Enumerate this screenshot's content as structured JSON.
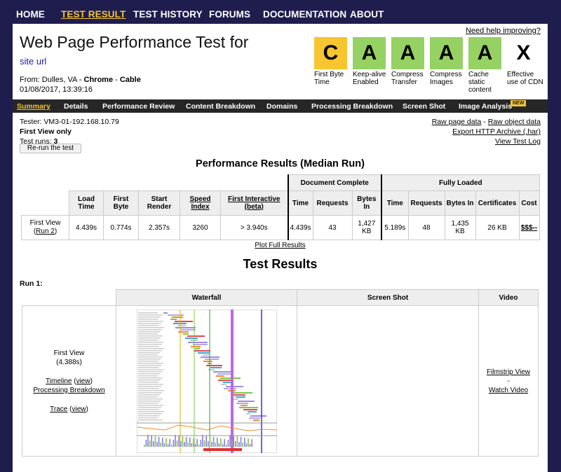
{
  "nav": {
    "items": [
      "HOME",
      "TEST RESULT",
      "TEST HISTORY",
      "FORUMS",
      "DOCUMENTATION",
      "ABOUT"
    ]
  },
  "header": {
    "title": "Web Page Performance Test for",
    "site": "site url",
    "from_label": "From:",
    "from_location": "Dulles, VA",
    "browser": "Chrome",
    "connection": "Cable",
    "timestamp": "01/08/2017, 13:39:16",
    "help_link": "Need help improving?"
  },
  "grades": [
    {
      "letter": "C",
      "label": "First Byte Time",
      "color": "#f7c52f"
    },
    {
      "letter": "A",
      "label": "Keep-alive Enabled",
      "color": "#96d163"
    },
    {
      "letter": "A",
      "label": "Compress Transfer",
      "color": "#96d163"
    },
    {
      "letter": "A",
      "label": "Compress Images",
      "color": "#96d163"
    },
    {
      "letter": "A",
      "label": "Cache static content",
      "color": "#96d163"
    },
    {
      "letter": "X",
      "label": "Effective use of CDN",
      "color": "#ffffff"
    }
  ],
  "subnav": {
    "items": [
      "Summary",
      "Details",
      "Performance Review",
      "Content Breakdown",
      "Domains",
      "Processing Breakdown",
      "Screen Shot",
      "Image Analysis"
    ],
    "badge": "NEW"
  },
  "tester": {
    "tester_line": "Tester: VM3-01-192.168.10.79",
    "view": "First View only",
    "runs_label": "Test runs:",
    "runs": "3",
    "rerun_button": "Re-run the test"
  },
  "raw_links": {
    "raw_page": "Raw page data",
    "sep": " - ",
    "raw_object": "Raw object data",
    "export": "Export HTTP Archive (.har)",
    "view_log": "View Test Log"
  },
  "performance": {
    "heading": "Performance Results (Median Run)",
    "group_doc": "Document Complete",
    "group_full": "Fully Loaded",
    "headers": {
      "load_time": "Load Time",
      "first_byte": "First Byte",
      "start_render": "Start Render",
      "speed_index": "Speed Index",
      "first_interactive": "First Interactive (beta)",
      "time": "Time",
      "requests": "Requests",
      "bytes_in": "Bytes In",
      "certificates": "Certificates",
      "cost": "Cost"
    },
    "row": {
      "label": "First View",
      "run_link": "Run 2",
      "load_time": "4.439s",
      "first_byte": "0.774s",
      "start_render": "2.357s",
      "speed_index": "3260",
      "first_interactive": "> 3.940s",
      "doc_time": "4.439s",
      "doc_requests": "43",
      "doc_bytes": "1,427 KB",
      "full_time": "5.189s",
      "full_requests": "48",
      "full_bytes": "1,435 KB",
      "certificates": "26 KB",
      "cost": "$$$--"
    },
    "plot_link": "Plot Full Results"
  },
  "results": {
    "heading": "Test Results",
    "run_label": "Run 1:",
    "col_waterfall": "Waterfall",
    "col_screenshot": "Screen Shot",
    "col_video": "Video",
    "first_view": "First View",
    "first_view_time": "(4.388s)",
    "timeline": "Timeline",
    "view": "view",
    "processing": "Processing Breakdown",
    "trace": "Trace",
    "filmstrip": "Filmstrip View",
    "dash": "-",
    "watch": "Watch Video"
  }
}
